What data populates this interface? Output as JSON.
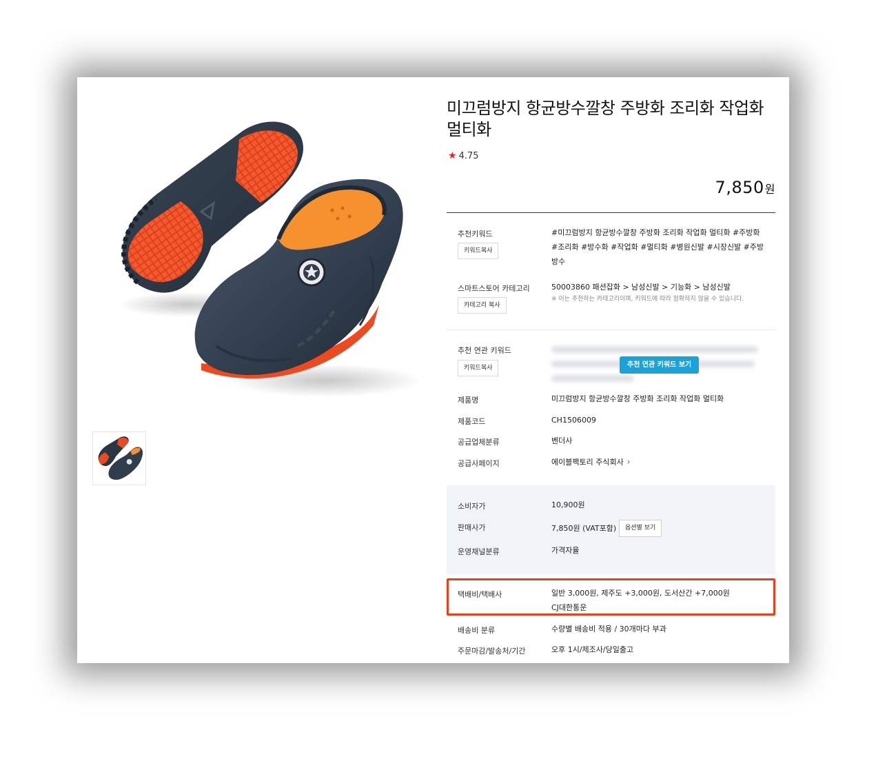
{
  "product": {
    "title": "미끄럼방지 항균방수깔창 주방화 조리화 작업화 멀티화",
    "rating": "4.75",
    "price": "7,850",
    "price_unit": "원"
  },
  "details": {
    "keywords_label": "추천키워드",
    "keywords_copy_btn": "키워드복사",
    "keywords_value": "#미끄럼방지 항균방수깔창 주방화 조리화 작업화 멀티화 #주방화 #조리화 #방수화 #작업화 #멀티화 #병원신발 #시장신발 #주방방수",
    "category_label": "스마트스토어 카테고리",
    "category_copy_btn": "카테고리 복사",
    "category_value": "50003860 패션잡화 > 남성신발 > 기능화 > 남성신발",
    "category_note": "※ 이는 추천하는 카테고리이며, 키워드에 따라 정확하지 않을 수 있습니다.",
    "related_label": "추천 연관 키워드",
    "related_copy_btn": "키워드복사",
    "related_view_btn": "추천 연관 키워드 보기",
    "name_label": "제품명",
    "name_value": "미끄럼방지 항균방수깔창 주방화 조리화 작업화 멀티화",
    "code_label": "제품코드",
    "code_value": "CH1506009",
    "supplier_type_label": "공급업체분류",
    "supplier_type_value": "벤더사",
    "supplier_page_label": "공급사페이지",
    "supplier_page_value": "에이블팩토리 주식회사",
    "supplier_page_arrow": "›"
  },
  "pricing": {
    "consumer_label": "소비자가",
    "consumer_value": "10,900원",
    "sale_label": "판매사가",
    "sale_value": "7,850원 (VAT포함)",
    "option_btn": "옵션별 보기",
    "channel_label": "운영채널분류",
    "channel_value": "가격자율"
  },
  "shipping": {
    "fee_label": "택배비/택배사",
    "fee_value": "일반 3,000원, 제주도 +3,000원, 도서산간 +7,000원",
    "courier_value": "CJ대한통운",
    "class_label": "배송비 분류",
    "class_value": "수량별 배송비 적용 / 30개마다 부과",
    "deadline_label": "주문마감/발송처/기간",
    "deadline_value": "오후 1시/제조사/당일출고"
  },
  "colors": {
    "accent_blue": "#1aa3d9",
    "highlight_red": "#e8401c",
    "star_red": "#e8202a",
    "shoe_navy": "#2e3c4b",
    "sole_orange": "#ee4a22",
    "insole_orange": "#f5912e"
  }
}
